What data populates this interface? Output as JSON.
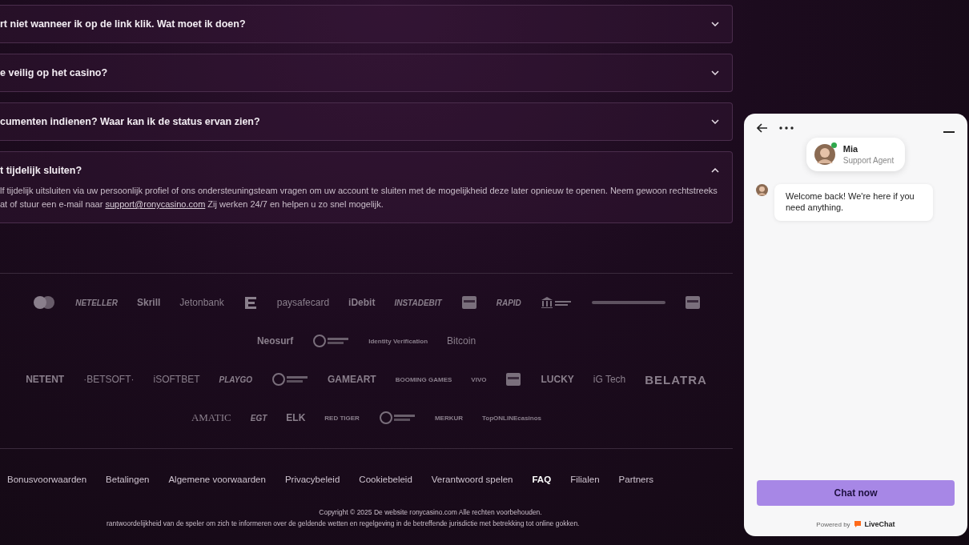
{
  "faq": [
    {
      "question": "rt niet wanneer ik op de link klik. Wat moet ik doen?",
      "expanded": false
    },
    {
      "question": "e veilig op het casino?",
      "expanded": false
    },
    {
      "question": "cumenten indienen? Waar kan ik de status ervan zien?",
      "expanded": false
    },
    {
      "question": "t tijdelijk sluiten?",
      "expanded": true,
      "answer": {
        "line_1": "lf tijdelijk uitsluiten via uw persoonlijk profiel of ons ondersteuningsteam vragen om uw account te sluiten met de mogelijkheid deze later opnieuw te openen. Neem gewoon rechtstreeks",
        "line_2_before": "at of stuur een e-mail naar",
        "link": "support@ronycasino.com",
        "line_2_after": "Zij werken 24/7 en helpen u zo snel mogelijk."
      }
    }
  ],
  "logo_rows": [
    [
      {
        "kind": "circles"
      },
      {
        "kind": "italic",
        "label": "NETELLER"
      },
      {
        "kind": "bold",
        "label": "Skrill"
      },
      {
        "kind": "light",
        "label": "Jetonbank"
      },
      {
        "kind": "letter-mark"
      },
      {
        "kind": "light",
        "label": "paysafecard"
      },
      {
        "kind": "bold",
        "label": "iDebit"
      },
      {
        "kind": "italic",
        "label": "INSTADEBIT"
      },
      {
        "kind": "card"
      },
      {
        "kind": "italic",
        "label": "RAPID"
      },
      {
        "kind": "bank"
      },
      {
        "kind": "strip"
      },
      {
        "kind": "card"
      }
    ],
    [
      {
        "kind": "bold",
        "label": "Neosurf"
      },
      {
        "kind": "crypto"
      },
      {
        "kind": "small",
        "label": "Identity Verification"
      },
      {
        "kind": "light",
        "label": "Bitcoin"
      }
    ],
    [
      {
        "kind": "bold",
        "label": "NETENT"
      },
      {
        "kind": "light",
        "label": "·BETSOFT·"
      },
      {
        "kind": "light",
        "label": "iSOFTBET"
      },
      {
        "kind": "italic",
        "label": "PLAYGO"
      },
      {
        "kind": "crypto"
      },
      {
        "kind": "bold",
        "label": "GAMEART"
      },
      {
        "kind": "small",
        "label": "BOOMING GAMES"
      },
      {
        "kind": "small",
        "label": "VIVO"
      },
      {
        "kind": "card"
      },
      {
        "kind": "bold",
        "label": "LUCKY"
      },
      {
        "kind": "light",
        "label": "iG Tech"
      },
      {
        "kind": "big",
        "label": "BELATRA"
      }
    ],
    [
      {
        "kind": "serif",
        "label": "AMATIC"
      },
      {
        "kind": "italic",
        "label": "EGT"
      },
      {
        "kind": "bold",
        "label": "ELK"
      },
      {
        "kind": "small",
        "label": "RED TIGER"
      },
      {
        "kind": "crypto"
      },
      {
        "kind": "small",
        "label": "MERKUR"
      },
      {
        "kind": "small",
        "label": "TopONLINEcasinos"
      }
    ]
  ],
  "footer_links": [
    {
      "label": "Bonusvoorwaarden",
      "selected": false
    },
    {
      "label": "Betalingen",
      "selected": false
    },
    {
      "label": "Algemene voorwaarden",
      "selected": false
    },
    {
      "label": "Privacybeleid",
      "selected": false
    },
    {
      "label": "Cookiebeleid",
      "selected": false
    },
    {
      "label": "Verantwoord spelen",
      "selected": false
    },
    {
      "label": "FAQ",
      "selected": true
    },
    {
      "label": "Filialen",
      "selected": false
    },
    {
      "label": "Partners",
      "selected": false
    }
  ],
  "copyright": "Copyright © 2025 De website ronycasino.com Alle rechten voorbehouden.",
  "disclaimer": "rantwoordelijkheid van de speler om zich te informeren over de geldende wetten en regelgeving in de betreffende jurisdictie met betrekking tot online gokken.",
  "chat": {
    "agent": {
      "name": "Mia",
      "role": "Support Agent",
      "online": true
    },
    "message": "Welcome back! We're here if you need anything.",
    "button": "Chat now",
    "powered_by": "Powered by",
    "brand": "LiveChat"
  }
}
